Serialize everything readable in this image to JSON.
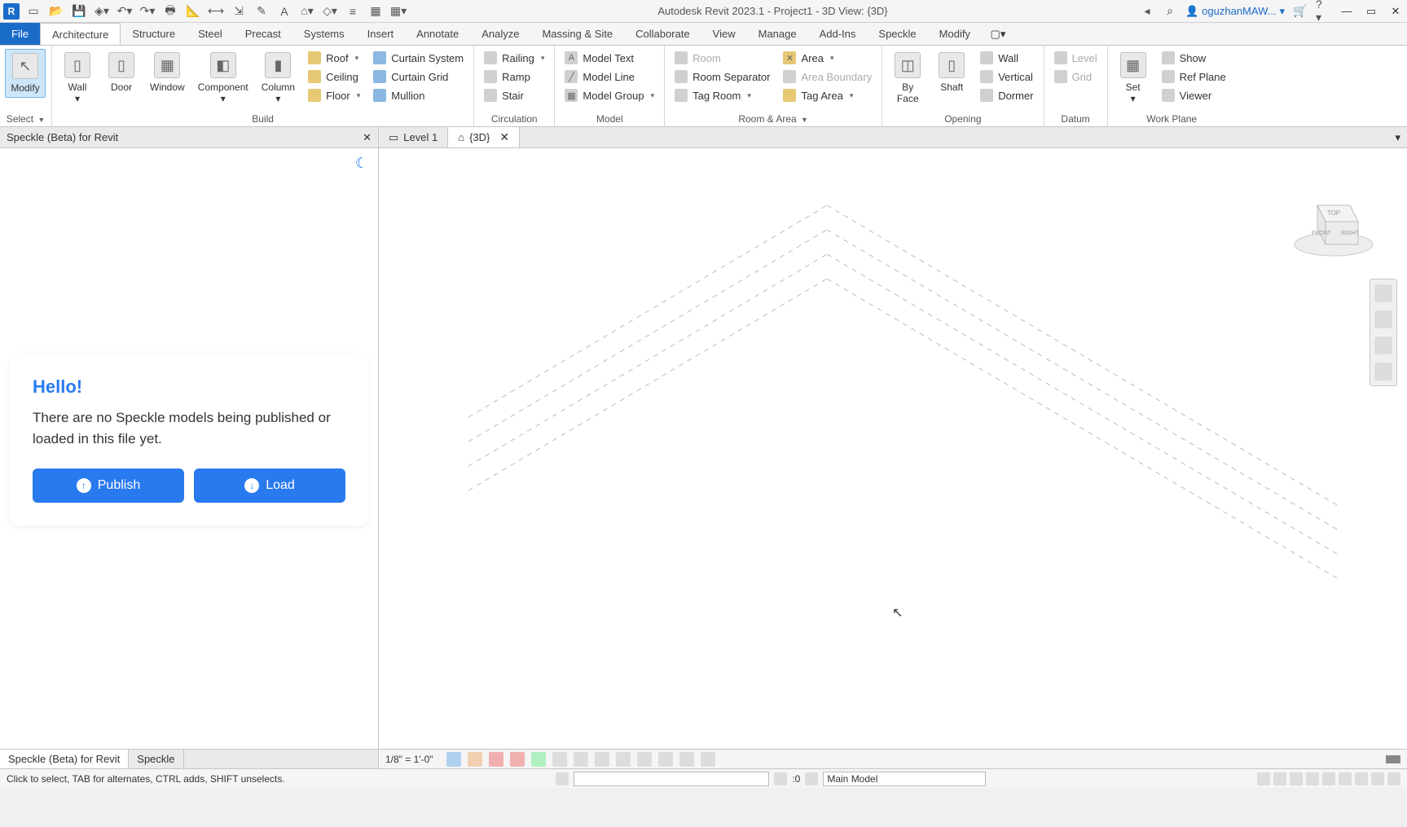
{
  "titlebar": {
    "app_logo": "R",
    "title": "Autodesk Revit 2023.1 - Project1 - 3D View: {3D}",
    "user": "oguzhanMAW...",
    "search_placeholder": ""
  },
  "ribbonTabs": [
    "File",
    "Architecture",
    "Structure",
    "Steel",
    "Precast",
    "Systems",
    "Insert",
    "Annotate",
    "Analyze",
    "Massing & Site",
    "Collaborate",
    "View",
    "Manage",
    "Add-Ins",
    "Speckle",
    "Modify"
  ],
  "ribbon": {
    "select_label": "Select",
    "modify_label": "Modify",
    "build": {
      "title": "Build",
      "wall": "Wall",
      "door": "Door",
      "window": "Window",
      "component": "Component",
      "column": "Column",
      "roof": "Roof",
      "ceiling": "Ceiling",
      "floor": "Floor",
      "curtain_system": "Curtain  System",
      "curtain_grid": "Curtain  Grid",
      "mullion": "Mullion"
    },
    "circulation": {
      "title": "Circulation",
      "railing": "Railing",
      "ramp": "Ramp",
      "stair": "Stair"
    },
    "model": {
      "title": "Model",
      "model_text": "Model  Text",
      "model_line": "Model  Line",
      "model_group": "Model  Group"
    },
    "roomarea": {
      "title": "Room & Area",
      "room": "Room",
      "room_separator": "Room  Separator",
      "tag_room": "Tag  Room",
      "area": "Area",
      "area_boundary": "Area  Boundary",
      "tag_area": "Tag  Area"
    },
    "opening": {
      "title": "Opening",
      "by_face": "By\nFace",
      "shaft": "Shaft",
      "wall": "Wall",
      "vertical": "Vertical",
      "dormer": "Dormer"
    },
    "datum": {
      "title": "Datum",
      "level": "Level",
      "grid": "Grid"
    },
    "workplane": {
      "title": "Work Plane",
      "set": "Set",
      "show": "Show",
      "ref_plane": "Ref  Plane",
      "viewer": "Viewer"
    }
  },
  "speckle": {
    "panel_title": "Speckle (Beta) for Revit",
    "hello": "Hello!",
    "message": "There are no Speckle models being published or loaded in this file yet.",
    "publish": "Publish",
    "load": "Load",
    "footer_tab1": "Speckle (Beta) for Revit",
    "footer_tab2": "Speckle"
  },
  "viewTabs": {
    "level1": "Level 1",
    "threeD": "{3D}"
  },
  "viewControl": {
    "scale": "1/8\" = 1'-0\""
  },
  "statusbar": {
    "hint": "Click to select, TAB for alternates, CTRL adds, SHIFT unselects.",
    "selection_count": ":0",
    "main_model": "Main Model"
  }
}
